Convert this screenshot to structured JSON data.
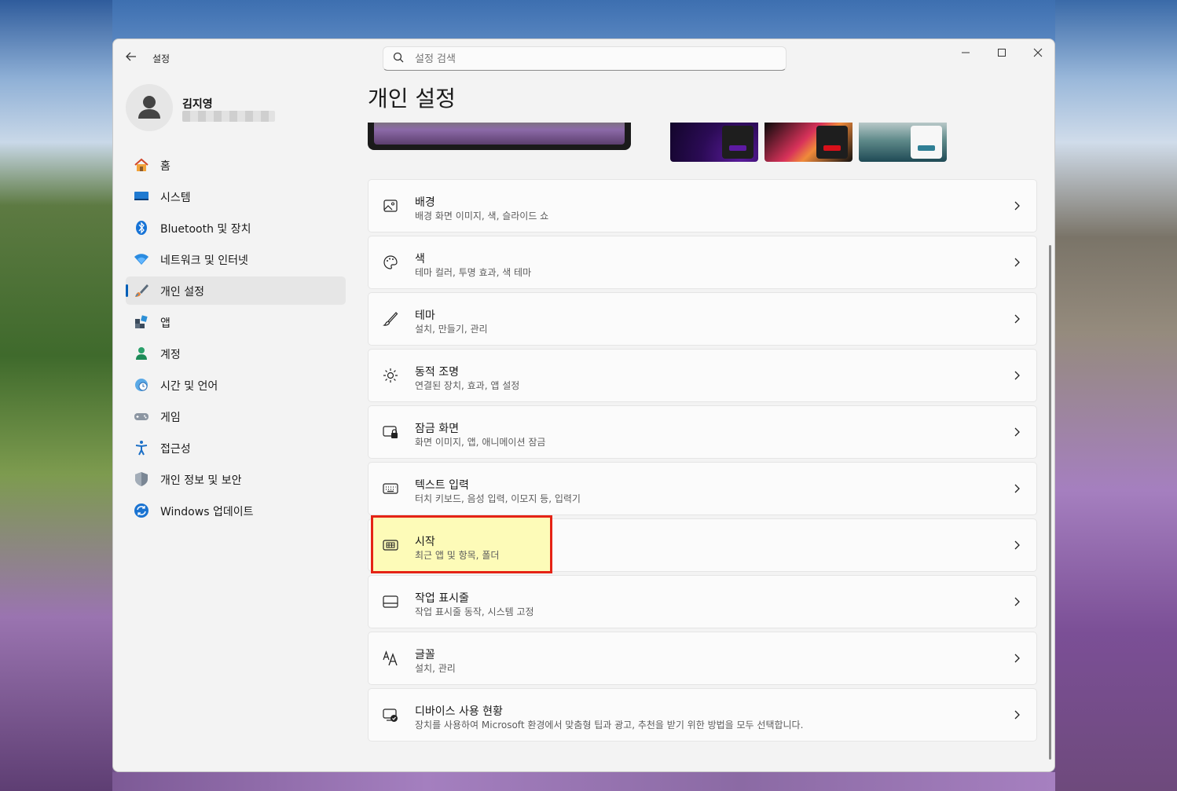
{
  "window": {
    "app_title": "설정",
    "search_placeholder": "설정 검색",
    "controls": {
      "minimize": "—",
      "maximize": "☐",
      "close": "✕"
    }
  },
  "profile": {
    "name": "김지영"
  },
  "sidebar": {
    "items": [
      {
        "label": "홈",
        "icon": "home-icon"
      },
      {
        "label": "시스템",
        "icon": "system-icon"
      },
      {
        "label": "Bluetooth 및 장치",
        "icon": "bluetooth-icon"
      },
      {
        "label": "네트워크 및 인터넷",
        "icon": "wifi-icon"
      },
      {
        "label": "개인 설정",
        "icon": "brush-icon",
        "active": true
      },
      {
        "label": "앱",
        "icon": "apps-icon"
      },
      {
        "label": "계정",
        "icon": "account-icon"
      },
      {
        "label": "시간 및 언어",
        "icon": "clock-globe-icon"
      },
      {
        "label": "게임",
        "icon": "gamepad-icon"
      },
      {
        "label": "접근성",
        "icon": "accessibility-icon"
      },
      {
        "label": "개인 정보 및 보안",
        "icon": "shield-icon"
      },
      {
        "label": "Windows 업데이트",
        "icon": "update-icon"
      }
    ]
  },
  "main": {
    "title": "개인 설정",
    "cards": [
      {
        "title": "배경",
        "subtitle": "배경 화면 이미지, 색, 슬라이드 쇼",
        "icon": "image-icon"
      },
      {
        "title": "색",
        "subtitle": "테마 컬러, 투명 효과, 색 테마",
        "icon": "palette-icon"
      },
      {
        "title": "테마",
        "subtitle": "설치, 만들기, 관리",
        "icon": "brush-icon"
      },
      {
        "title": "동적 조명",
        "subtitle": "연결된 장치, 효과, 앱 설정",
        "icon": "lighting-icon"
      },
      {
        "title": "잠금 화면",
        "subtitle": "화면 이미지, 앱, 애니메이션 잠금",
        "icon": "lock-screen-icon"
      },
      {
        "title": "텍스트 입력",
        "subtitle": "터치 키보드, 음성 입력, 이모지 등, 입력기",
        "icon": "keyboard-icon"
      },
      {
        "title": "시작",
        "subtitle": "최근 앱 및 항목, 폴더",
        "icon": "start-icon",
        "highlighted": true
      },
      {
        "title": "작업 표시줄",
        "subtitle": "작업 표시줄 동작, 시스템 고정",
        "icon": "taskbar-icon"
      },
      {
        "title": "글꼴",
        "subtitle": "설치, 관리",
        "icon": "font-icon"
      },
      {
        "title": "디바이스 사용 현황",
        "subtitle": "장치를 사용하여 Microsoft 환경에서 맞춤형 팁과 광고, 추천을 받기 위한 방법을 모두 선택합니다.",
        "icon": "device-usage-icon"
      }
    ]
  },
  "colors": {
    "accent": "#005fb8",
    "highlight_border": "#e52315",
    "highlight_fill": "#fdfbb8"
  }
}
